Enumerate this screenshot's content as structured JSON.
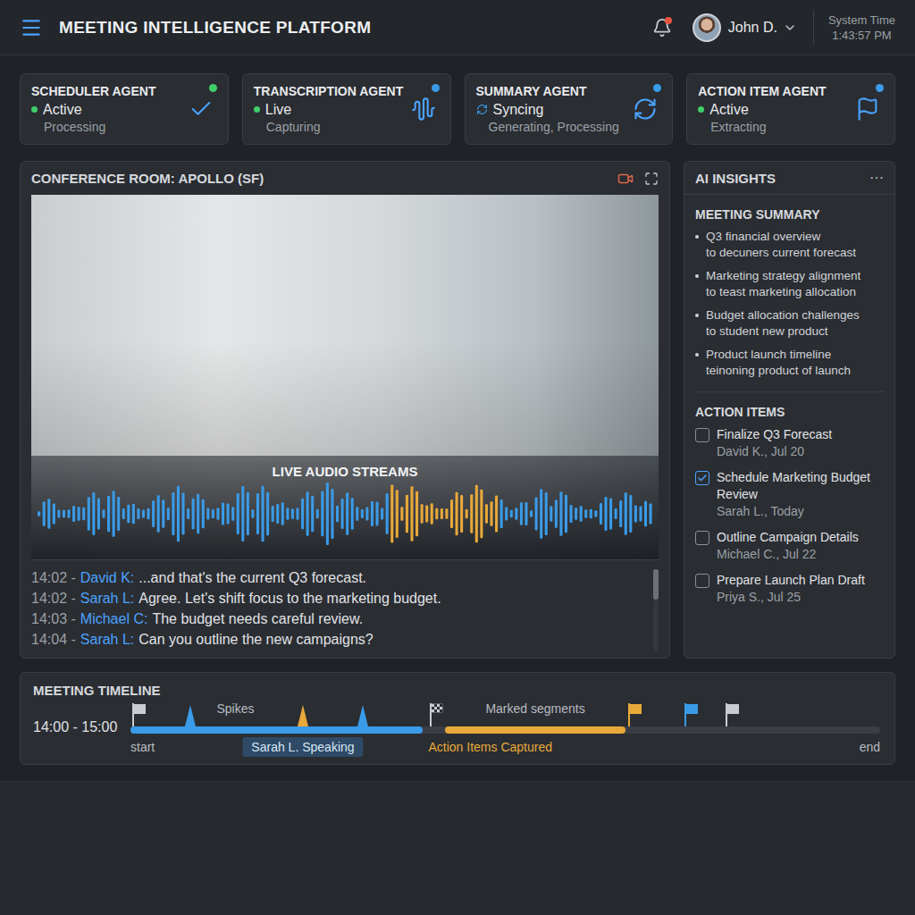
{
  "header": {
    "title": "MEETING INTELLIGENCE PLATFORM",
    "notifications": {
      "unread": true
    },
    "user": {
      "name": "John D."
    },
    "clock": {
      "label": "System Time",
      "time": "1:43:57 PM"
    }
  },
  "agents": [
    {
      "kind": "scheduler",
      "title": "SCHEDULER AGENT",
      "status": "Active",
      "detail": "Processing",
      "indicator": "dot",
      "indicator_color": "#3ecf6a",
      "color": "#3ecf6a"
    },
    {
      "kind": "transcription",
      "title": "TRANSCRIPTION AGENT",
      "status": "Live",
      "detail": "Capturing",
      "indicator": "dot",
      "indicator_color": "#3ecf6a",
      "color": "#3a9be8"
    },
    {
      "kind": "summary",
      "title": "SUMMARY AGENT",
      "status": "Syncing",
      "detail": "Generating, Processing",
      "indicator": "sync",
      "indicator_color": "#3a9be8",
      "color": "#3a9be8"
    },
    {
      "kind": "action",
      "title": "ACTION ITEM AGENT",
      "status": "Active",
      "detail": "Extracting",
      "indicator": "dot",
      "indicator_color": "#3ecf6a",
      "color": "#3a9be8"
    }
  ],
  "room": {
    "title": "CONFERENCE ROOM: APOLLO (SF)",
    "recording": true,
    "audio": {
      "title": "LIVE AUDIO STREAMS",
      "color": "#3a9be8",
      "highlight_color": "#e8a93a",
      "highlight_from": 0.57,
      "highlight_to": 0.75
    },
    "transcript": [
      {
        "time": "14:02 -",
        "speaker": "David K:",
        "text": "...and that's the current Q3 forecast."
      },
      {
        "time": "14:02 -",
        "speaker": "Sarah L:",
        "text": "Agree. Let's shift focus to the marketing budget."
      },
      {
        "time": "14:03 -",
        "speaker": "Michael C:",
        "text": "The budget needs careful review."
      },
      {
        "time": "14:04 -",
        "speaker": "Sarah L:",
        "text": "Can you outline the new campaigns?"
      }
    ]
  },
  "insights": {
    "title": "AI INSIGHTS",
    "more": "···",
    "summary": {
      "title": "MEETING SUMMARY",
      "items": [
        {
          "lines": [
            "Q3 financial overview",
            "to decuners current forecast"
          ]
        },
        {
          "lines": [
            "Marketing strategy alignment",
            "to teast marketing allocation"
          ]
        },
        {
          "lines": [
            "Budget allocation challenges",
            "to student new product"
          ]
        },
        {
          "lines": [
            "Product launch timeline",
            "teinoning product of launch"
          ]
        }
      ]
    },
    "actions": {
      "title": "ACTION ITEMS",
      "items": [
        {
          "title": "Finalize Q3 Forecast",
          "meta": "David K., Jul 20",
          "checked": false
        },
        {
          "title": "Schedule Marketing Budget Review",
          "meta": "Sarah L., Today",
          "checked": true
        },
        {
          "title": "Outline Campaign Details",
          "meta": "Michael C., Jul 22",
          "checked": false
        },
        {
          "title": "Prepare Launch Plan Draft",
          "meta": "Priya S., Jul 25",
          "checked": false
        }
      ]
    }
  },
  "timeline": {
    "title": "MEETING TIMELINE",
    "range": "14:00 - 15:00",
    "segments": [
      {
        "from": 0,
        "to": 0.39,
        "color": "#3a9be8"
      },
      {
        "from": 0.42,
        "to": 0.66,
        "color": "#e8a93a"
      }
    ],
    "markers": [
      {
        "kind": "flag",
        "at": 0.004,
        "color": "#c8ccd2"
      },
      {
        "kind": "spike",
        "at": 0.08,
        "color": "#3a9be8"
      },
      {
        "kind": "spike",
        "at": 0.23,
        "color": "#e8a93a"
      },
      {
        "kind": "spike",
        "at": 0.31,
        "color": "#3a9be8"
      },
      {
        "kind": "checkered",
        "at": 0.4,
        "color": "#c8ccd2"
      },
      {
        "kind": "flag",
        "at": 0.665,
        "color": "#e8a93a"
      },
      {
        "kind": "flag",
        "at": 0.74,
        "color": "#3a9be8"
      },
      {
        "kind": "flag",
        "at": 0.795,
        "color": "#c8ccd2"
      }
    ],
    "labels_above": [
      {
        "text": "Spikes",
        "at": 0.14
      },
      {
        "text": "Marked segments",
        "at": 0.54
      }
    ],
    "labels_below": [
      {
        "text": "start",
        "at": 0,
        "kind": "plain"
      },
      {
        "text": "Sarah L. Speaking",
        "at": 0.23,
        "kind": "badge"
      },
      {
        "text": "Action Items Captured",
        "at": 0.48,
        "kind": "accent"
      },
      {
        "text": "end",
        "at": 1,
        "kind": "plain"
      }
    ]
  }
}
